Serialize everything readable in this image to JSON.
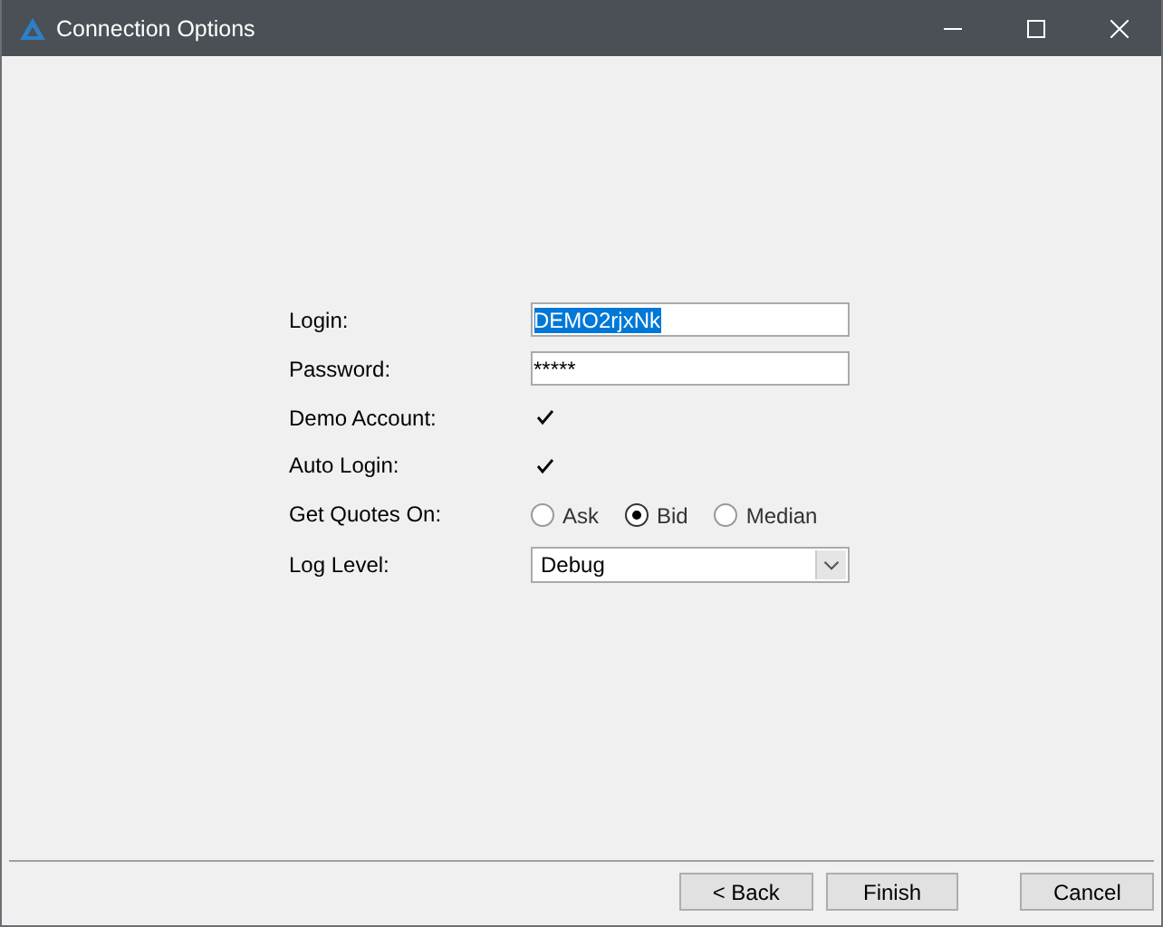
{
  "window": {
    "title": "Connection Options"
  },
  "form": [
    {
      "kind": "text",
      "label": "Login:",
      "value": "DEMO2rjxNk",
      "highlighted": true
    },
    {
      "kind": "text",
      "label": "Password:",
      "value": "*****",
      "highlighted": false
    },
    {
      "kind": "checkbox",
      "label": "Demo Account:",
      "checked": true
    },
    {
      "kind": "checkbox",
      "label": "Auto Login:",
      "checked": true
    },
    {
      "kind": "radio",
      "label": "Get Quotes On:",
      "options": [
        {
          "label": "Ask",
          "selected": false
        },
        {
          "label": "Bid",
          "selected": true
        },
        {
          "label": "Median",
          "selected": false
        }
      ]
    },
    {
      "kind": "select",
      "label": "Log Level:",
      "value": "Debug"
    }
  ],
  "buttons": [
    "< Back",
    "Finish",
    "Cancel"
  ]
}
